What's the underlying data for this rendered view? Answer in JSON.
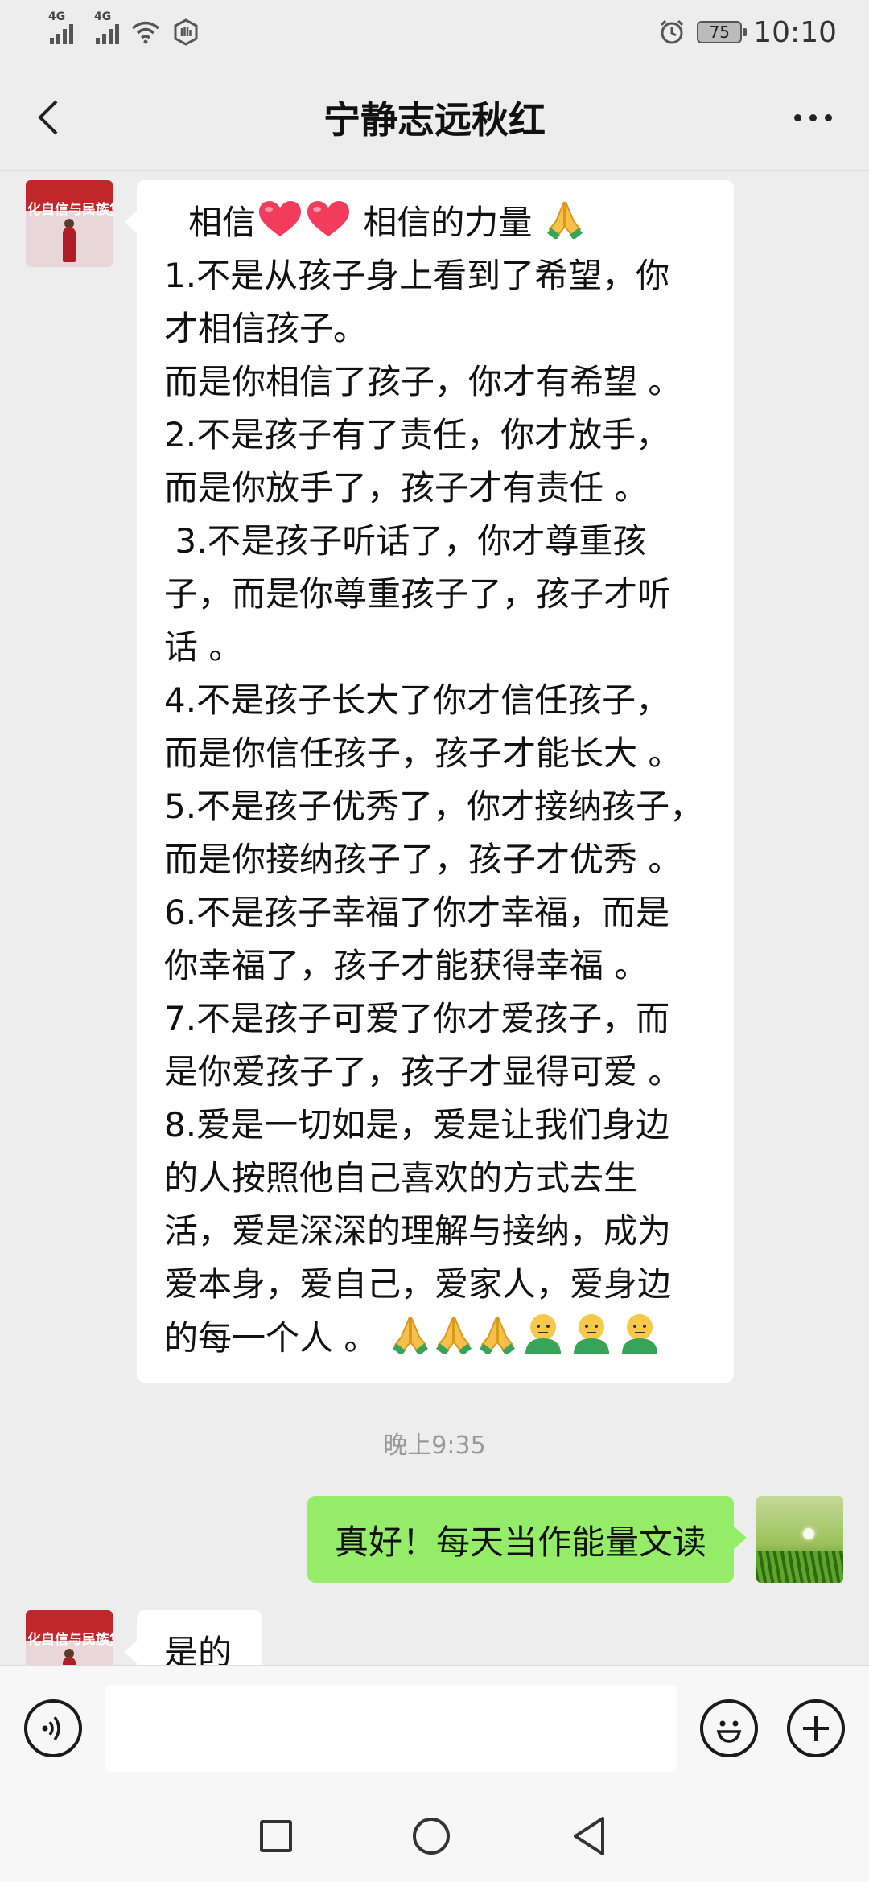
{
  "status_bar": {
    "net1": "4G",
    "net2": "4G",
    "battery": "75",
    "time": "10:10"
  },
  "header": {
    "title": "宁静志远秋红"
  },
  "contact_avatar_text": "化自信与民族复",
  "messages": {
    "first": {
      "line0": "相信",
      "line0_mid": "相信的力量",
      "lines": [
        "1.不是从孩子身上看到了希望，你",
        "才相信孩子。",
        "而是你相信了孩子，你才有希望 。",
        "2.不是孩子有了责任，你才放手，",
        "而是你放手了，孩子才有责任 。",
        " 3.不是孩子听话了，你才尊重孩",
        "子，而是你尊重孩子了，孩子才听",
        "话 。",
        "4.不是孩子长大了你才信任孩子，",
        "而是你信任孩子，孩子才能长大 。",
        "5.不是孩子优秀了，你才接纳孩子，",
        "而是你接纳孩子了，孩子才优秀 。",
        "6.不是孩子幸福了你才幸福，而是",
        "你幸福了，孩子才能获得幸福 。",
        "7.不是孩子可爱了你才爱孩子，而",
        "是你爱孩子了，孩子才显得可爱 。",
        "8.爱是一切如是，爱是让我们身边",
        "的人按照他自己喜欢的方式去生",
        "活，爱是深深的理解与接纳，成为",
        "爱本身，爱自己，爱家人，爱身边"
      ],
      "last_line": "的每一个人 。"
    },
    "timestamp": "晚上9:35",
    "reply": "真好！每天当作能量文读",
    "partial": "是的"
  },
  "icons": [
    "back-icon",
    "more-icon",
    "heart-icon",
    "pray-icon",
    "person-icon",
    "voice-icon",
    "emoji-icon",
    "plus-icon"
  ],
  "colors": {
    "my_bubble": "#95ec69",
    "their_bubble": "#ffffff",
    "background": "#ededed"
  },
  "input": {
    "value": ""
  }
}
